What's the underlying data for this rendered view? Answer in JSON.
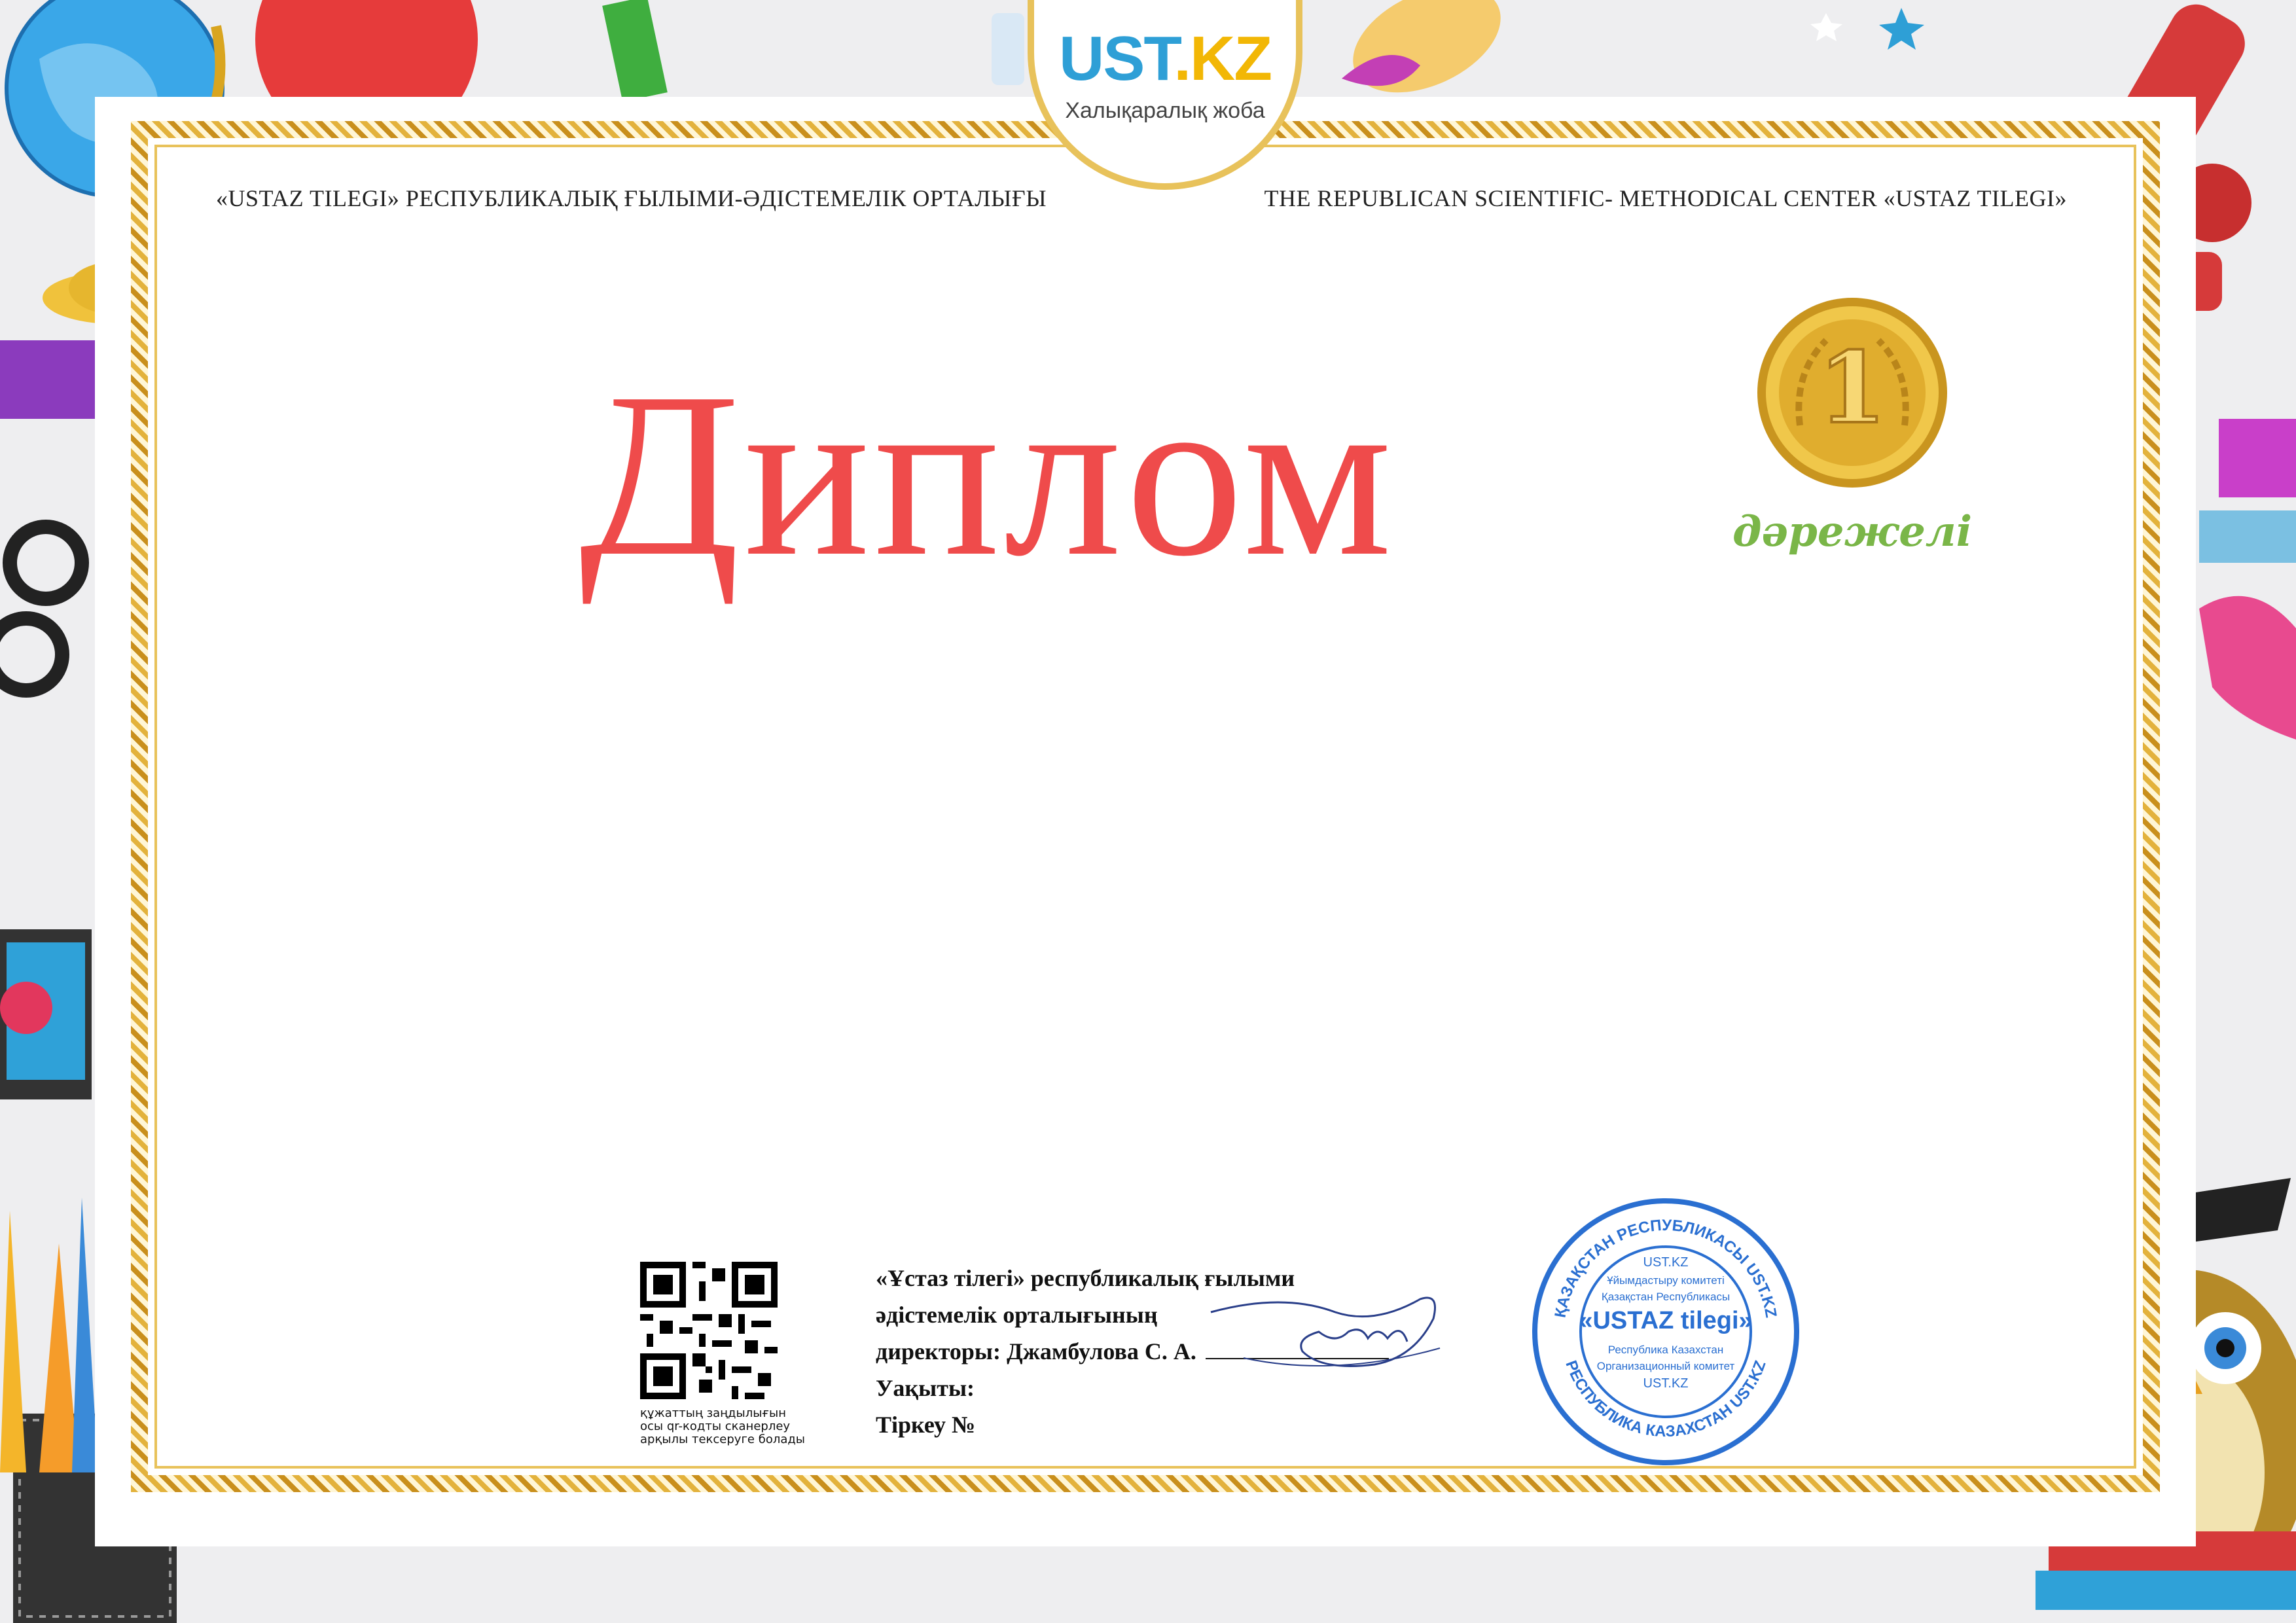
{
  "header": {
    "left_text": "«USTAZ TILEGI» РЕСПУБЛИКАЛЫҚ ҒЫЛЫМИ-ӘДІСТЕМЕЛІК ОРТАЛЫҒЫ",
    "right_text": "THE REPUBLICAN SCIENTIFIC- METHODICAL CENTER «USTAZ TILEGI»"
  },
  "logo": {
    "brand_part1": "UST",
    "brand_part2": ".KZ",
    "subtitle": "Халықаралық жоба"
  },
  "title": "Диплом",
  "award": {
    "place": "1",
    "degree_label": "дәрежелі"
  },
  "qr": {
    "caption_line1": "құжаттың заңдылығын",
    "caption_line2": "осы qr-кодты сканерлеу",
    "caption_line3": "арқылы тексеруге болады"
  },
  "signature_block": {
    "line1": "«Ұстаз тілегі» республикалық ғылыми",
    "line2": "әдістемелік орталығының",
    "line3": "директоры: Джамбулова С. А.",
    "time_label": "Уақыты:",
    "reg_label": "Тіркеу №"
  },
  "stamp": {
    "ring_top": "ҚАЗАҚСТАН РЕСПУБЛИКАСЫ UST.KZ",
    "ring_bottom": "РЕСПУБЛИКА КАЗАХСТАН UST.KZ",
    "line1": "UST.KZ",
    "line2": "Ұйымдастыру комитеті",
    "line3": "Қазақстан Республикасы",
    "center": "«USTAZ tilegi»",
    "line4": "Республика Казахстан",
    "line5": "Организационный комитет",
    "line6": "UST.KZ"
  },
  "colors": {
    "title": "#ef4b4b",
    "degree": "#7ab648",
    "gold": "#e3b23c",
    "stamp_blue": "#2a6fd1"
  }
}
